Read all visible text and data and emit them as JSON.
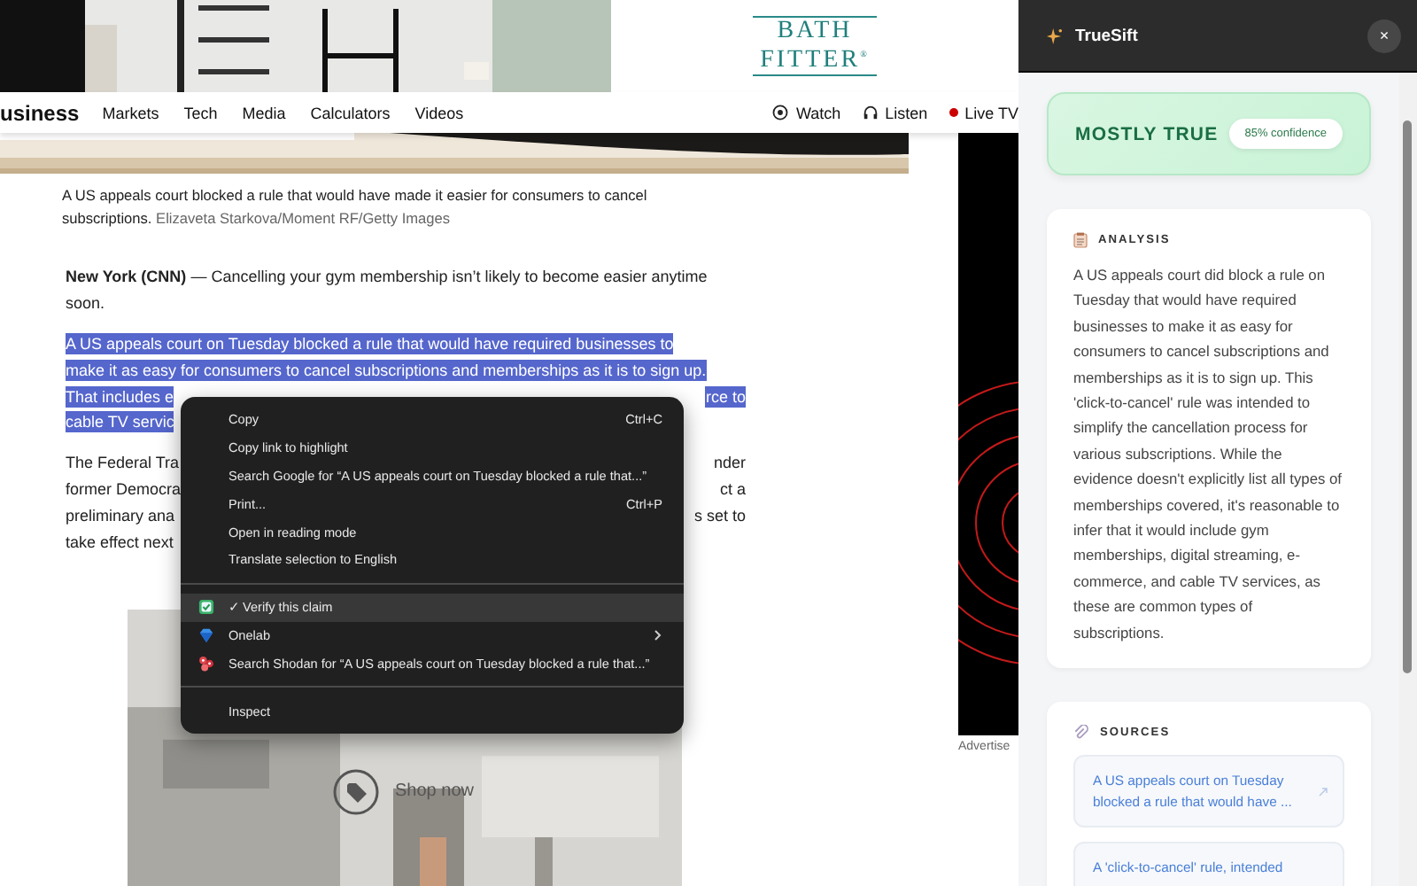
{
  "banner_ad": {
    "logo_lines": [
      "BATH",
      "FITTER"
    ],
    "logo_mark": "®"
  },
  "nav": {
    "section": "usiness",
    "links": [
      "Markets",
      "Tech",
      "Media",
      "Calculators",
      "Videos"
    ],
    "actions": [
      {
        "label": "Watch"
      },
      {
        "label": "Listen"
      },
      {
        "label": "Live TV"
      }
    ]
  },
  "caption": {
    "lines": [
      "A US appeals court blocked a rule that would have made it easier for consumers to cancel",
      "subscriptions."
    ],
    "credit": "Elizaveta Starkova/Moment RF/Getty Images"
  },
  "article": {
    "paragraphs": [
      {
        "highlighted": false,
        "lines": [
          {
            "left": "**New York (CNN)** — Cancelling your gym membership isn’t likely to become easier anytime"
          },
          {
            "left": "soon."
          }
        ]
      },
      {
        "highlighted": true,
        "lines": [
          {
            "left": "A US appeals court on Tuesday blocked a rule that would have required businesses to"
          },
          {
            "left": "make it as easy for consumers to cancel subscriptions and memberships as it is to sign up."
          },
          {
            "left": "That includes e",
            "right": "rce to"
          },
          {
            "left": "cable TV servic"
          }
        ]
      },
      {
        "highlighted": false,
        "lines": [
          {
            "left": "The Federal Tra",
            "right": "nder"
          },
          {
            "left": "former Democra",
            "right": "ct a"
          },
          {
            "left": "preliminary ana",
            "right": "s set to"
          },
          {
            "left": "take effect next"
          }
        ]
      }
    ]
  },
  "video_overlay": {
    "action": "Shop now"
  },
  "side_ad": {
    "label": "Advertise"
  },
  "context_menu": {
    "groups": [
      [
        {
          "label": "Copy",
          "shortcut": "Ctrl+C",
          "selected": false
        },
        {
          "label": "Copy link to highlight",
          "selected": false
        },
        {
          "label": "Search Google for “A US appeals court on Tuesday blocked a rule that...”",
          "selected": false
        },
        {
          "label": "Print...",
          "shortcut": "Ctrl+P",
          "selected": false
        },
        {
          "label": "Open in reading mode",
          "selected": false
        },
        {
          "label": "Translate selection to English",
          "selected": false
        }
      ],
      [
        {
          "label": "✓ Verify this claim",
          "selected": true
        },
        {
          "label": "Onelab",
          "submenu": true,
          "selected": false
        },
        {
          "label": "Search Shodan for “A US appeals court on Tuesday blocked a rule that...”",
          "selected": false
        }
      ],
      [
        {
          "label": "Inspect",
          "selected": false
        }
      ]
    ]
  },
  "panel": {
    "title": "TrueSift",
    "close": "×",
    "verdict": {
      "label": "MOSTLY TRUE",
      "confidence": "85% confidence"
    },
    "analysis": {
      "heading": "ANALYSIS",
      "text": "A US appeals court did block a rule on Tuesday that would have required businesses to make it as easy for consumers to cancel subscriptions and memberships as it is to sign up. This 'click-to-cancel' rule was intended to simplify the cancellation process for various subscriptions. While the evidence doesn't explicitly list all types of memberships covered, it's reasonable to infer that it would include gym memberships, digital streaming, e-commerce, and cable TV services, as these are common types of subscriptions."
    },
    "sources": {
      "heading": "SOURCES",
      "items": [
        {
          "text": "A US appeals court on Tuesday blocked a rule that would have ..."
        },
        {
          "text": "A 'click-to-cancel' rule, intended"
        }
      ]
    }
  }
}
